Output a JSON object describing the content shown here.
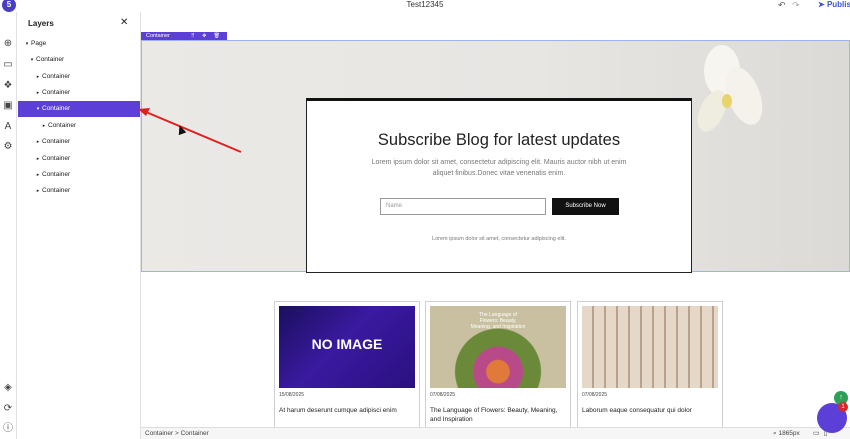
{
  "topbar": {
    "logo": "5",
    "title": "Test12345",
    "undo_icon": "↶",
    "redo_icon": "↷",
    "publish": "Publis"
  },
  "rail": {
    "icons": [
      "plus-circle-icon",
      "rectangle-icon",
      "components-icon",
      "pages-icon",
      "typography-icon",
      "gear-icon",
      "layers-icon",
      "sync-icon",
      "info-icon"
    ]
  },
  "layers": {
    "title": "Layers",
    "close": "✕",
    "items": [
      {
        "label": "Page",
        "caret": "▾"
      },
      {
        "label": "Container",
        "caret": "▾"
      },
      {
        "label": "Container",
        "caret": "▸"
      },
      {
        "label": "Container",
        "caret": "▸"
      },
      {
        "label": "Container",
        "caret": "▾",
        "selected": true
      },
      {
        "label": "Container",
        "caret": "▸"
      },
      {
        "label": "Container",
        "caret": "▸"
      },
      {
        "label": "Container",
        "caret": "▸"
      },
      {
        "label": "Container",
        "caret": "▸"
      },
      {
        "label": "Container",
        "caret": "▸"
      }
    ]
  },
  "canvas": {
    "selection_tag": "Container",
    "selection_tools": "⠿ ✥ 🗑",
    "subscribe": {
      "heading": "Subscribe Blog for latest updates",
      "text": "Lorem ipsum dolor sit amet, consectetur adipiscing elit. Mauris auctor nibh ut enim aliquet finibus.Donec vitae venenatis enim.",
      "input_placeholder": "Name",
      "button": "Subscribe Now",
      "small": "Lorem ipsum dolor sit amet, consectetur adipiscing elit."
    },
    "posts": [
      {
        "image": "NO IMAGE",
        "date": "15/08/2025",
        "title": "At harum deserunt cumque adipisci enim"
      },
      {
        "image": "The Language of Flowers: Beauty, Meaning, and Inspiration",
        "date": "07/08/2025",
        "title": "The Language of Flowers: Beauty, Meaning, and Inspiration"
      },
      {
        "image": "",
        "date": "07/08/2025",
        "title": "Laborum eaque consequatur qui dolor"
      }
    ]
  },
  "bottombar": {
    "crumb1": "Container",
    "crumb_sep": ">",
    "crumb2": "Container",
    "zoom": "1865px"
  },
  "chat": {
    "badge": "1",
    "up": "↑"
  },
  "colors": {
    "accent": "#5b3fd6",
    "arrow": "#e02020"
  }
}
